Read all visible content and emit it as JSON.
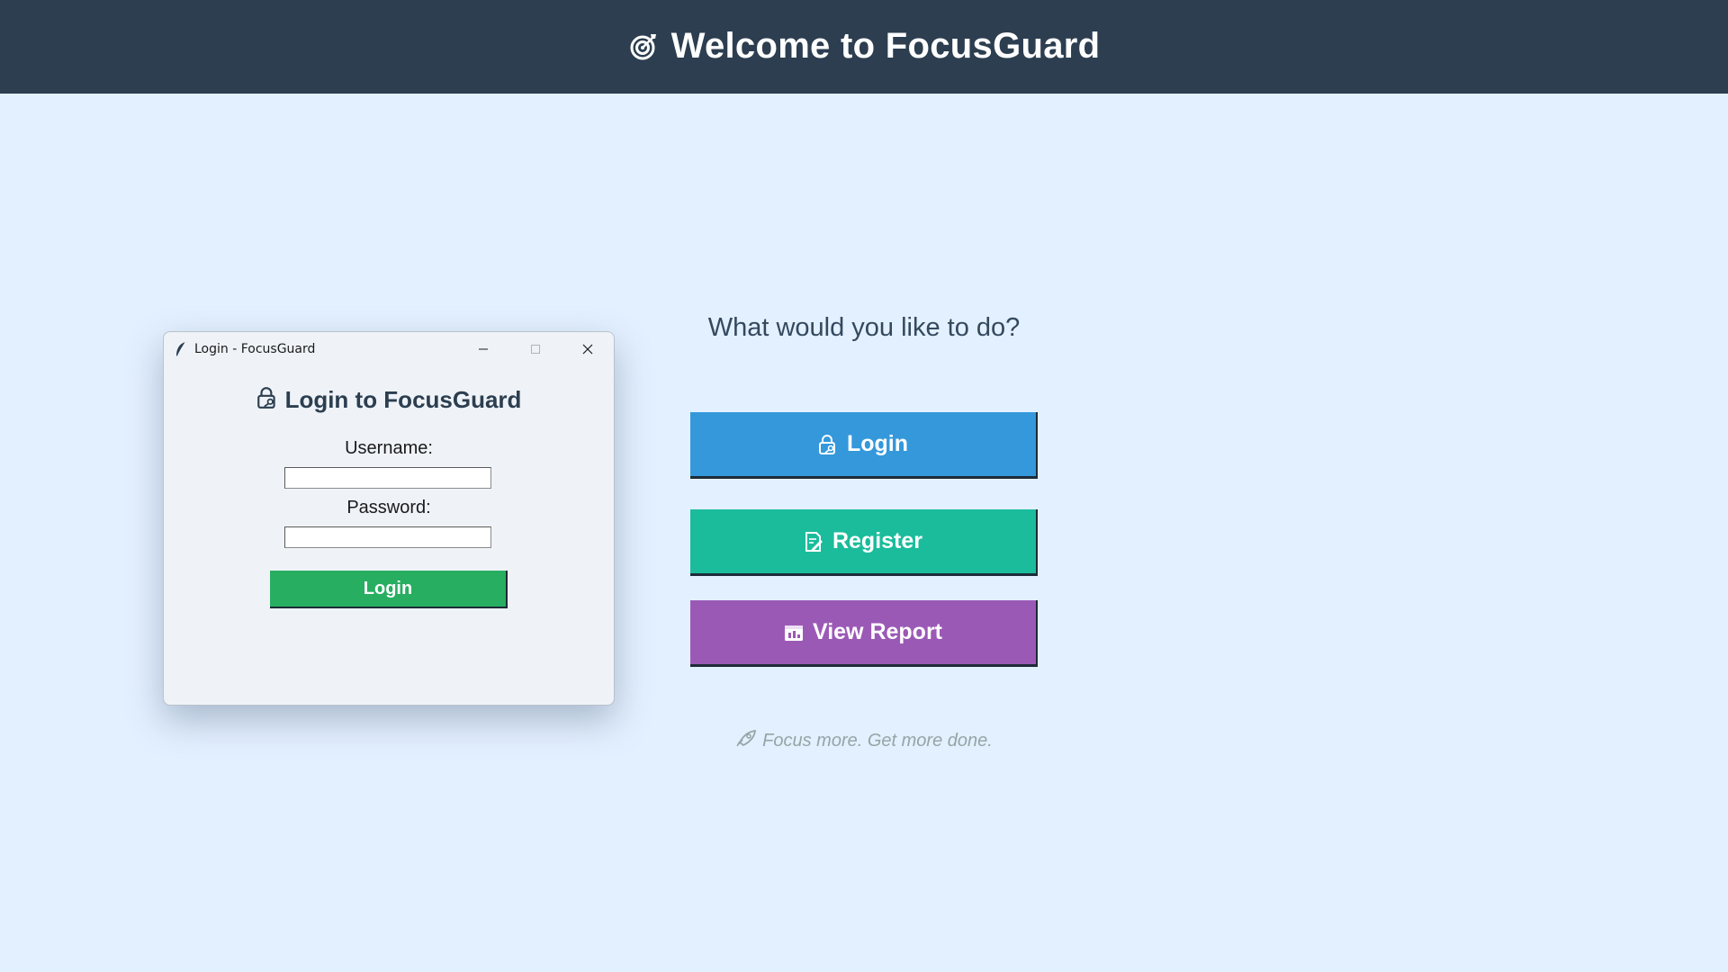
{
  "header": {
    "title": "Welcome to FocusGuard",
    "icon": "target-icon"
  },
  "main": {
    "prompt": "What would you like to do?",
    "buttons": {
      "login": {
        "label": "Login",
        "icon": "lock-key-icon",
        "color": "#3498db"
      },
      "register": {
        "label": "Register",
        "icon": "memo-icon",
        "color": "#1abc9c"
      },
      "report": {
        "label": "View Report",
        "icon": "chart-icon",
        "color": "#9b59b6"
      }
    },
    "tagline": "Focus more. Get more done.",
    "tagline_icon": "rocket-icon"
  },
  "login_dialog": {
    "window_title": "Login - FocusGuard",
    "heading": "Login to FocusGuard",
    "username_label": "Username:",
    "username_value": "",
    "password_label": "Password:",
    "password_value": "",
    "submit_label": "Login",
    "submit_color": "#27ae60"
  },
  "colors": {
    "header_bg": "#2c3e50",
    "page_bg": "#e3f0ff",
    "dialog_bg": "#eff3f8"
  }
}
